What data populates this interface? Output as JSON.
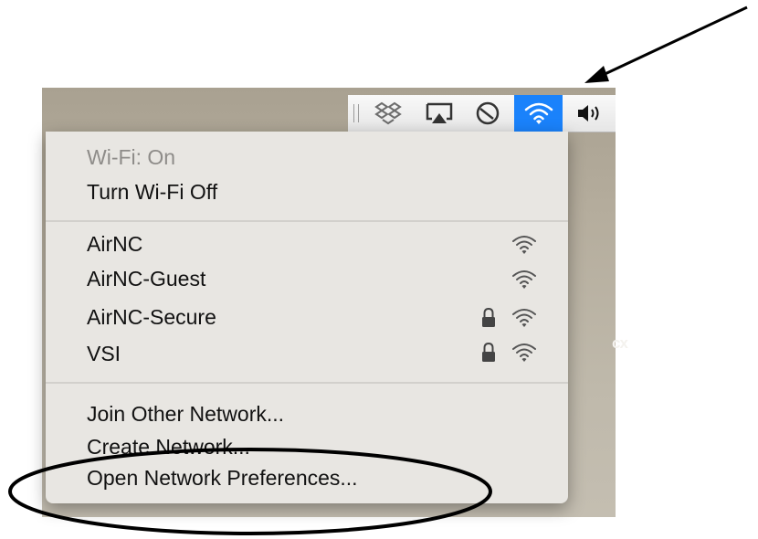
{
  "desktop": {
    "partial_text": "cx"
  },
  "menubar": {
    "icons": [
      "dropbox-icon",
      "airplay-icon",
      "time-machine-icon",
      "wifi-icon",
      "volume-icon"
    ],
    "accent": "#1a82fb"
  },
  "wifi_menu": {
    "status": "Wi-Fi: On",
    "toggle": "Turn Wi-Fi Off",
    "networks": [
      {
        "name": "AirNC",
        "locked": false
      },
      {
        "name": "AirNC-Guest",
        "locked": false
      },
      {
        "name": "AirNC-Secure",
        "locked": true
      },
      {
        "name": "VSI",
        "locked": true
      }
    ],
    "actions": {
      "join": "Join Other Network...",
      "create": "Create Network...",
      "prefs": "Open Network Preferences..."
    }
  }
}
